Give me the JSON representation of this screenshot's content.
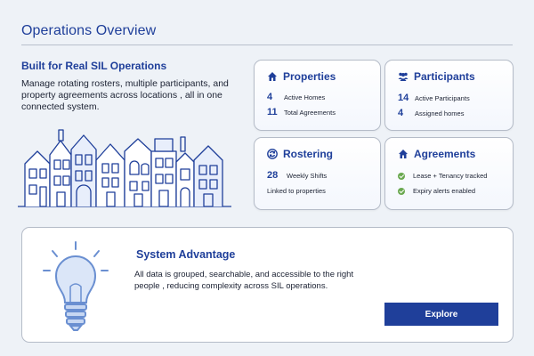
{
  "header": {
    "title": "Operations Overview"
  },
  "hero": {
    "heading": "Built for Real SIL Operations",
    "description": "Manage rotating rosters, multiple participants, and property agreements across locations , all in one connected system."
  },
  "cards": {
    "properties": {
      "title": "Properties",
      "icon": "home-icon",
      "rows": [
        {
          "num": "4",
          "label": "Active Homes"
        },
        {
          "num": "11",
          "label": "Total Agreements"
        }
      ]
    },
    "participants": {
      "title": "Participants",
      "icon": "people-icon",
      "rows": [
        {
          "num": "14",
          "label": "Active Participants"
        },
        {
          "num": "4",
          "label": "Assigned homes"
        }
      ]
    },
    "rostering": {
      "title": "Rostering",
      "icon": "refresh-icon",
      "rows": [
        {
          "num": "28",
          "label": "Weekly Shifts"
        },
        {
          "label": "Linked to properties"
        }
      ]
    },
    "agreements": {
      "title": "Agreements",
      "icon": "home-icon",
      "rows": [
        {
          "label": "Lease + Tenancy tracked"
        },
        {
          "label": "Expiry alerts enabled"
        }
      ]
    }
  },
  "advantage": {
    "title": "System Advantage",
    "description": "All data is grouped, searchable, and accessible to the right people , reducing complexity across SIL operations.",
    "button_label": "Explore"
  },
  "colors": {
    "accent": "#1f3f9a",
    "check": "#6aa84f",
    "background": "#eef2f7"
  }
}
